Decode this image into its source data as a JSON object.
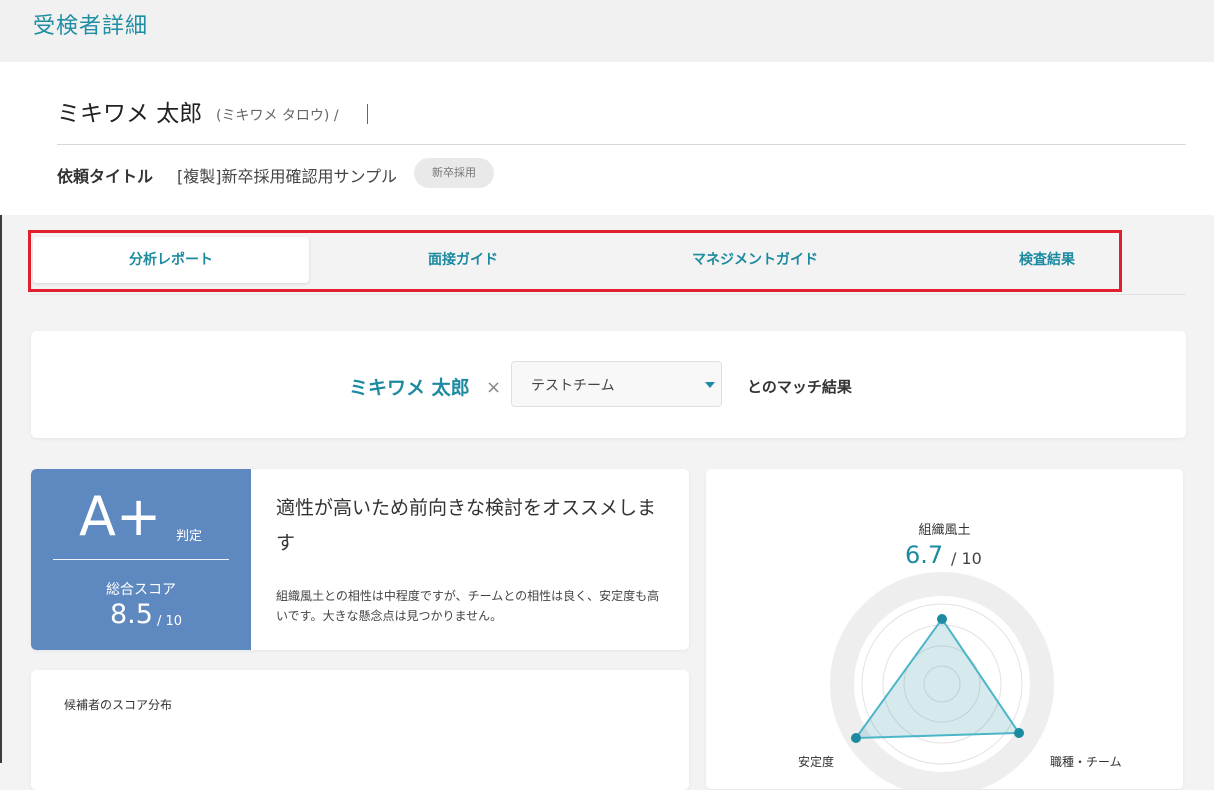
{
  "header": {
    "title": "受検者詳細"
  },
  "candidate": {
    "name": "ミキワメ 太郎",
    "kana": "(ミキワメ タロウ) /",
    "request_label": "依頼タイトル",
    "request_title": "[複製]新卒採用確認用サンプル",
    "request_tag": "新卒採用"
  },
  "tabs": [
    {
      "label": "分析レポート",
      "active": true
    },
    {
      "label": "面接ガイド",
      "active": false
    },
    {
      "label": "マネジメントガイド",
      "active": false
    },
    {
      "label": "検査結果",
      "active": false
    }
  ],
  "match": {
    "name": "ミキワメ 太郎",
    "times": "×",
    "team_selected": "テストチーム",
    "suffix": "とのマッチ結果"
  },
  "grade": {
    "letter": "A+",
    "label": "判定",
    "total_label": "総合スコア",
    "total_score": "8.5",
    "total_max": "/ 10",
    "color": "#5e88c0"
  },
  "verdict": {
    "title": "適性が高いため前向きな検討をオススメします",
    "body": "組織風土との相性は中程度ですが、チームとの相性は良く、安定度も高いです。大きな懸念点は見つかりません。"
  },
  "distribution": {
    "title": "候補者のスコア分布"
  },
  "radar": {
    "top_label": "組織風土",
    "top_score": "6.7",
    "top_max": "/ 10",
    "left_label": "安定度",
    "right_label": "職種・チーム",
    "accent": "#1c8aa0"
  },
  "colors": {
    "accent": "#1c8aa0",
    "highlight": "#e2202b"
  }
}
